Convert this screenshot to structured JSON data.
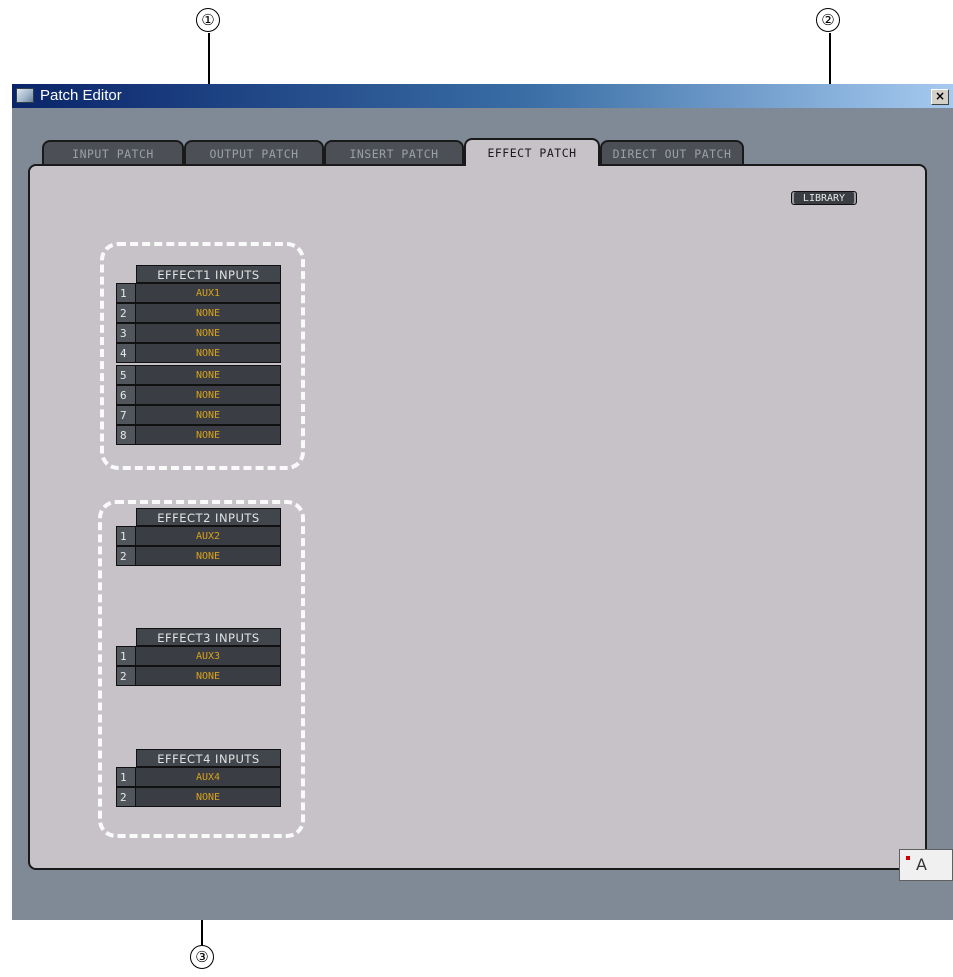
{
  "callouts": [
    "①",
    "②",
    "③"
  ],
  "window": {
    "title": "Patch Editor",
    "close_glyph": "×"
  },
  "tabs": [
    {
      "label": "INPUT PATCH",
      "active": false
    },
    {
      "label": "OUTPUT PATCH",
      "active": false
    },
    {
      "label": "INSERT PATCH",
      "active": false
    },
    {
      "label": "EFFECT PATCH",
      "active": true
    },
    {
      "label": "DIRECT OUT PATCH",
      "active": false
    }
  ],
  "library_button": "LIBRARY",
  "effects": [
    {
      "header": "EFFECT1  INPUTS",
      "rows": [
        {
          "num": "1",
          "value": "AUX1"
        },
        {
          "num": "2",
          "value": "NONE"
        },
        {
          "num": "3",
          "value": "NONE"
        },
        {
          "num": "4",
          "value": "NONE"
        },
        {
          "num": "5",
          "value": "NONE"
        },
        {
          "num": "6",
          "value": "NONE"
        },
        {
          "num": "7",
          "value": "NONE"
        },
        {
          "num": "8",
          "value": "NONE"
        }
      ]
    },
    {
      "header": "EFFECT2  INPUTS",
      "rows": [
        {
          "num": "1",
          "value": "AUX2"
        },
        {
          "num": "2",
          "value": "NONE"
        }
      ]
    },
    {
      "header": "EFFECT3  INPUTS",
      "rows": [
        {
          "num": "1",
          "value": "AUX3"
        },
        {
          "num": "2",
          "value": "NONE"
        }
      ]
    },
    {
      "header": "EFFECT4  INPUTS",
      "rows": [
        {
          "num": "1",
          "value": "AUX4"
        },
        {
          "num": "2",
          "value": "NONE"
        }
      ]
    }
  ],
  "ime_bar": {
    "text": "A",
    "icon": "ime-toolbar-icon"
  },
  "colors": {
    "value_text": "#d9a21a",
    "panel": "#c6c2c8",
    "titlebar_start": "#0a246a",
    "titlebar_end": "#a6caf0"
  }
}
